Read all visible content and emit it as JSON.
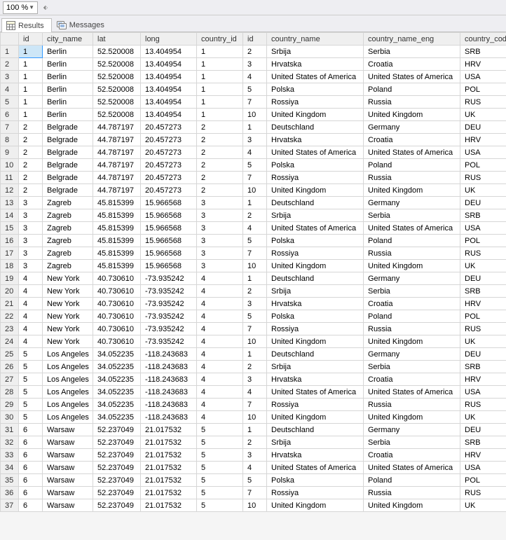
{
  "toolbar": {
    "zoom_value": "100 %"
  },
  "tabs": {
    "results": "Results",
    "messages": "Messages"
  },
  "grid": {
    "columns": [
      "id",
      "city_name",
      "lat",
      "long",
      "country_id",
      "id",
      "country_name",
      "country_name_eng",
      "country_code"
    ],
    "rows": [
      {
        "n": "1",
        "id": "1",
        "city": "Berlin",
        "lat": "52.520008",
        "long": "13.404954",
        "cid": "1",
        "id2": "2",
        "cname": "Srbija",
        "eng": "Serbia",
        "code": "SRB"
      },
      {
        "n": "2",
        "id": "1",
        "city": "Berlin",
        "lat": "52.520008",
        "long": "13.404954",
        "cid": "1",
        "id2": "3",
        "cname": "Hrvatska",
        "eng": "Croatia",
        "code": "HRV"
      },
      {
        "n": "3",
        "id": "1",
        "city": "Berlin",
        "lat": "52.520008",
        "long": "13.404954",
        "cid": "1",
        "id2": "4",
        "cname": "United States of America",
        "eng": "United States of America",
        "code": "USA"
      },
      {
        "n": "4",
        "id": "1",
        "city": "Berlin",
        "lat": "52.520008",
        "long": "13.404954",
        "cid": "1",
        "id2": "5",
        "cname": "Polska",
        "eng": "Poland",
        "code": "POL"
      },
      {
        "n": "5",
        "id": "1",
        "city": "Berlin",
        "lat": "52.520008",
        "long": "13.404954",
        "cid": "1",
        "id2": "7",
        "cname": "Rossiya",
        "eng": "Russia",
        "code": "RUS"
      },
      {
        "n": "6",
        "id": "1",
        "city": "Berlin",
        "lat": "52.520008",
        "long": "13.404954",
        "cid": "1",
        "id2": "10",
        "cname": "United Kingdom",
        "eng": "United Kingdom",
        "code": "UK"
      },
      {
        "n": "7",
        "id": "2",
        "city": "Belgrade",
        "lat": "44.787197",
        "long": "20.457273",
        "cid": "2",
        "id2": "1",
        "cname": "Deutschland",
        "eng": "Germany",
        "code": "DEU"
      },
      {
        "n": "8",
        "id": "2",
        "city": "Belgrade",
        "lat": "44.787197",
        "long": "20.457273",
        "cid": "2",
        "id2": "3",
        "cname": "Hrvatska",
        "eng": "Croatia",
        "code": "HRV"
      },
      {
        "n": "9",
        "id": "2",
        "city": "Belgrade",
        "lat": "44.787197",
        "long": "20.457273",
        "cid": "2",
        "id2": "4",
        "cname": "United States of America",
        "eng": "United States of America",
        "code": "USA"
      },
      {
        "n": "10",
        "id": "2",
        "city": "Belgrade",
        "lat": "44.787197",
        "long": "20.457273",
        "cid": "2",
        "id2": "5",
        "cname": "Polska",
        "eng": "Poland",
        "code": "POL"
      },
      {
        "n": "11",
        "id": "2",
        "city": "Belgrade",
        "lat": "44.787197",
        "long": "20.457273",
        "cid": "2",
        "id2": "7",
        "cname": "Rossiya",
        "eng": "Russia",
        "code": "RUS"
      },
      {
        "n": "12",
        "id": "2",
        "city": "Belgrade",
        "lat": "44.787197",
        "long": "20.457273",
        "cid": "2",
        "id2": "10",
        "cname": "United Kingdom",
        "eng": "United Kingdom",
        "code": "UK"
      },
      {
        "n": "13",
        "id": "3",
        "city": "Zagreb",
        "lat": "45.815399",
        "long": "15.966568",
        "cid": "3",
        "id2": "1",
        "cname": "Deutschland",
        "eng": "Germany",
        "code": "DEU"
      },
      {
        "n": "14",
        "id": "3",
        "city": "Zagreb",
        "lat": "45.815399",
        "long": "15.966568",
        "cid": "3",
        "id2": "2",
        "cname": "Srbija",
        "eng": "Serbia",
        "code": "SRB"
      },
      {
        "n": "15",
        "id": "3",
        "city": "Zagreb",
        "lat": "45.815399",
        "long": "15.966568",
        "cid": "3",
        "id2": "4",
        "cname": "United States of America",
        "eng": "United States of America",
        "code": "USA"
      },
      {
        "n": "16",
        "id": "3",
        "city": "Zagreb",
        "lat": "45.815399",
        "long": "15.966568",
        "cid": "3",
        "id2": "5",
        "cname": "Polska",
        "eng": "Poland",
        "code": "POL"
      },
      {
        "n": "17",
        "id": "3",
        "city": "Zagreb",
        "lat": "45.815399",
        "long": "15.966568",
        "cid": "3",
        "id2": "7",
        "cname": "Rossiya",
        "eng": "Russia",
        "code": "RUS"
      },
      {
        "n": "18",
        "id": "3",
        "city": "Zagreb",
        "lat": "45.815399",
        "long": "15.966568",
        "cid": "3",
        "id2": "10",
        "cname": "United Kingdom",
        "eng": "United Kingdom",
        "code": "UK"
      },
      {
        "n": "19",
        "id": "4",
        "city": "New York",
        "lat": "40.730610",
        "long": "-73.935242",
        "cid": "4",
        "id2": "1",
        "cname": "Deutschland",
        "eng": "Germany",
        "code": "DEU"
      },
      {
        "n": "20",
        "id": "4",
        "city": "New York",
        "lat": "40.730610",
        "long": "-73.935242",
        "cid": "4",
        "id2": "2",
        "cname": "Srbija",
        "eng": "Serbia",
        "code": "SRB"
      },
      {
        "n": "21",
        "id": "4",
        "city": "New York",
        "lat": "40.730610",
        "long": "-73.935242",
        "cid": "4",
        "id2": "3",
        "cname": "Hrvatska",
        "eng": "Croatia",
        "code": "HRV"
      },
      {
        "n": "22",
        "id": "4",
        "city": "New York",
        "lat": "40.730610",
        "long": "-73.935242",
        "cid": "4",
        "id2": "5",
        "cname": "Polska",
        "eng": "Poland",
        "code": "POL"
      },
      {
        "n": "23",
        "id": "4",
        "city": "New York",
        "lat": "40.730610",
        "long": "-73.935242",
        "cid": "4",
        "id2": "7",
        "cname": "Rossiya",
        "eng": "Russia",
        "code": "RUS"
      },
      {
        "n": "24",
        "id": "4",
        "city": "New York",
        "lat": "40.730610",
        "long": "-73.935242",
        "cid": "4",
        "id2": "10",
        "cname": "United Kingdom",
        "eng": "United Kingdom",
        "code": "UK"
      },
      {
        "n": "25",
        "id": "5",
        "city": "Los Angeles",
        "lat": "34.052235",
        "long": "-118.243683",
        "cid": "4",
        "id2": "1",
        "cname": "Deutschland",
        "eng": "Germany",
        "code": "DEU"
      },
      {
        "n": "26",
        "id": "5",
        "city": "Los Angeles",
        "lat": "34.052235",
        "long": "-118.243683",
        "cid": "4",
        "id2": "2",
        "cname": "Srbija",
        "eng": "Serbia",
        "code": "SRB"
      },
      {
        "n": "27",
        "id": "5",
        "city": "Los Angeles",
        "lat": "34.052235",
        "long": "-118.243683",
        "cid": "4",
        "id2": "3",
        "cname": "Hrvatska",
        "eng": "Croatia",
        "code": "HRV"
      },
      {
        "n": "28",
        "id": "5",
        "city": "Los Angeles",
        "lat": "34.052235",
        "long": "-118.243683",
        "cid": "4",
        "id2": "4",
        "cname": "United States of America",
        "eng": "United States of America",
        "code": "USA"
      },
      {
        "n": "29",
        "id": "5",
        "city": "Los Angeles",
        "lat": "34.052235",
        "long": "-118.243683",
        "cid": "4",
        "id2": "7",
        "cname": "Rossiya",
        "eng": "Russia",
        "code": "RUS"
      },
      {
        "n": "30",
        "id": "5",
        "city": "Los Angeles",
        "lat": "34.052235",
        "long": "-118.243683",
        "cid": "4",
        "id2": "10",
        "cname": "United Kingdom",
        "eng": "United Kingdom",
        "code": "UK"
      },
      {
        "n": "31",
        "id": "6",
        "city": "Warsaw",
        "lat": "52.237049",
        "long": "21.017532",
        "cid": "5",
        "id2": "1",
        "cname": "Deutschland",
        "eng": "Germany",
        "code": "DEU"
      },
      {
        "n": "32",
        "id": "6",
        "city": "Warsaw",
        "lat": "52.237049",
        "long": "21.017532",
        "cid": "5",
        "id2": "2",
        "cname": "Srbija",
        "eng": "Serbia",
        "code": "SRB"
      },
      {
        "n": "33",
        "id": "6",
        "city": "Warsaw",
        "lat": "52.237049",
        "long": "21.017532",
        "cid": "5",
        "id2": "3",
        "cname": "Hrvatska",
        "eng": "Croatia",
        "code": "HRV"
      },
      {
        "n": "34",
        "id": "6",
        "city": "Warsaw",
        "lat": "52.237049",
        "long": "21.017532",
        "cid": "5",
        "id2": "4",
        "cname": "United States of America",
        "eng": "United States of America",
        "code": "USA"
      },
      {
        "n": "35",
        "id": "6",
        "city": "Warsaw",
        "lat": "52.237049",
        "long": "21.017532",
        "cid": "5",
        "id2": "5",
        "cname": "Polska",
        "eng": "Poland",
        "code": "POL"
      },
      {
        "n": "36",
        "id": "6",
        "city": "Warsaw",
        "lat": "52.237049",
        "long": "21.017532",
        "cid": "5",
        "id2": "7",
        "cname": "Rossiya",
        "eng": "Russia",
        "code": "RUS"
      },
      {
        "n": "37",
        "id": "6",
        "city": "Warsaw",
        "lat": "52.237049",
        "long": "21.017532",
        "cid": "5",
        "id2": "10",
        "cname": "United Kingdom",
        "eng": "United Kingdom",
        "code": "UK"
      }
    ]
  }
}
